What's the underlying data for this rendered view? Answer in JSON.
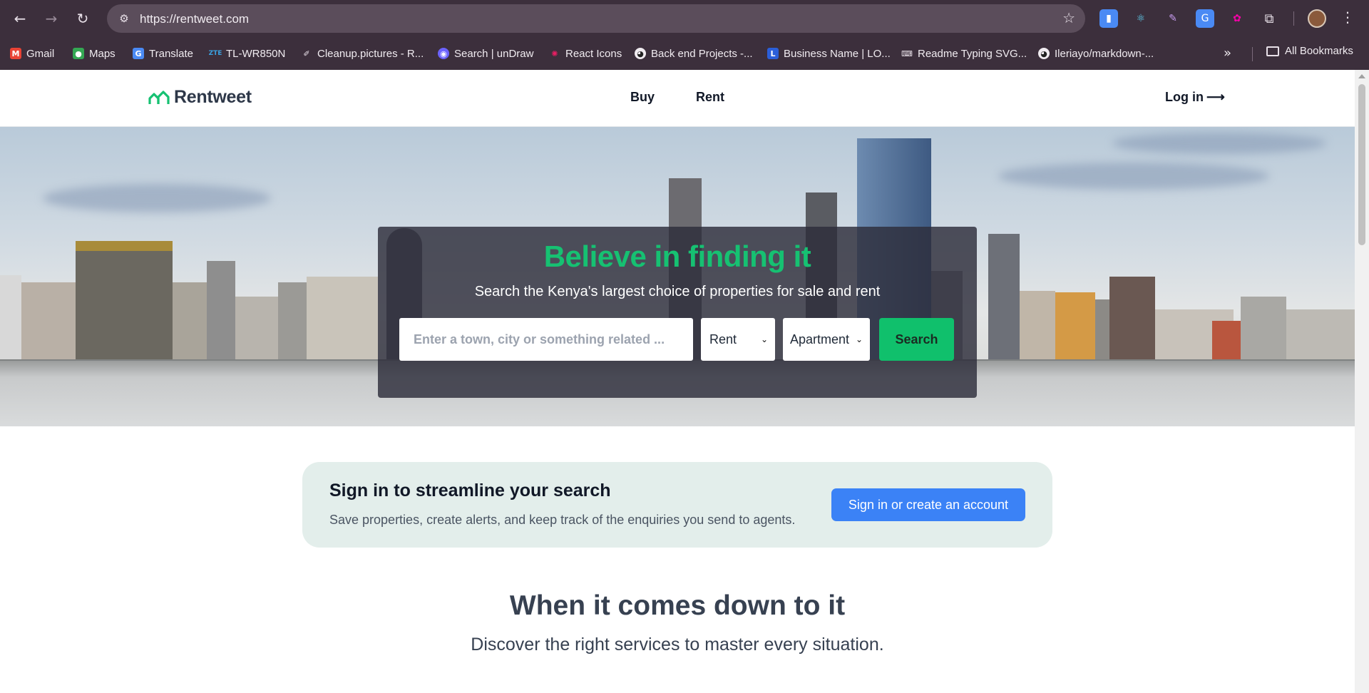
{
  "browser": {
    "url": "https://rentweet.com",
    "bookmarks": [
      {
        "label": "Gmail",
        "icon": "gmail-icon"
      },
      {
        "label": "Maps",
        "icon": "maps-icon"
      },
      {
        "label": "Translate",
        "icon": "translate-icon"
      },
      {
        "label": "TL-WR850N",
        "icon": "router-icon"
      },
      {
        "label": "Cleanup.pictures - R...",
        "icon": "brush-icon"
      },
      {
        "label": "Search | unDraw",
        "icon": "undraw-icon"
      },
      {
        "label": "React Icons",
        "icon": "react-icons-icon"
      },
      {
        "label": "Back end Projects -...",
        "icon": "github-icon"
      },
      {
        "label": "Business Name | LO...",
        "icon": "logo-maker-icon"
      },
      {
        "label": "Readme Typing SVG...",
        "icon": "keyboard-icon"
      },
      {
        "label": "Ileriayo/markdown-...",
        "icon": "github-icon"
      }
    ],
    "all_bookmarks": "All Bookmarks"
  },
  "site": {
    "brand": "Rentweet",
    "brand_color": "#16c172",
    "nav": {
      "buy": "Buy",
      "rent": "Rent"
    },
    "login": "Log in",
    "login_arrow": "⟶"
  },
  "hero": {
    "title": "Believe in finding it",
    "subtitle": "Search the Kenya's largest choice of properties for sale and rent",
    "search_placeholder": "Enter a town, city or something related ...",
    "listing_type": "Rent",
    "property_type": "Apartment",
    "search_button": "Search"
  },
  "signin": {
    "title": "Sign in to streamline your search",
    "subtitle": "Save properties, create alerts, and keep track of the enquiries you send to agents.",
    "button": "Sign in or create an account"
  },
  "services": {
    "title": "When it comes down to it",
    "subtitle": "Discover the right services to master every situation."
  }
}
